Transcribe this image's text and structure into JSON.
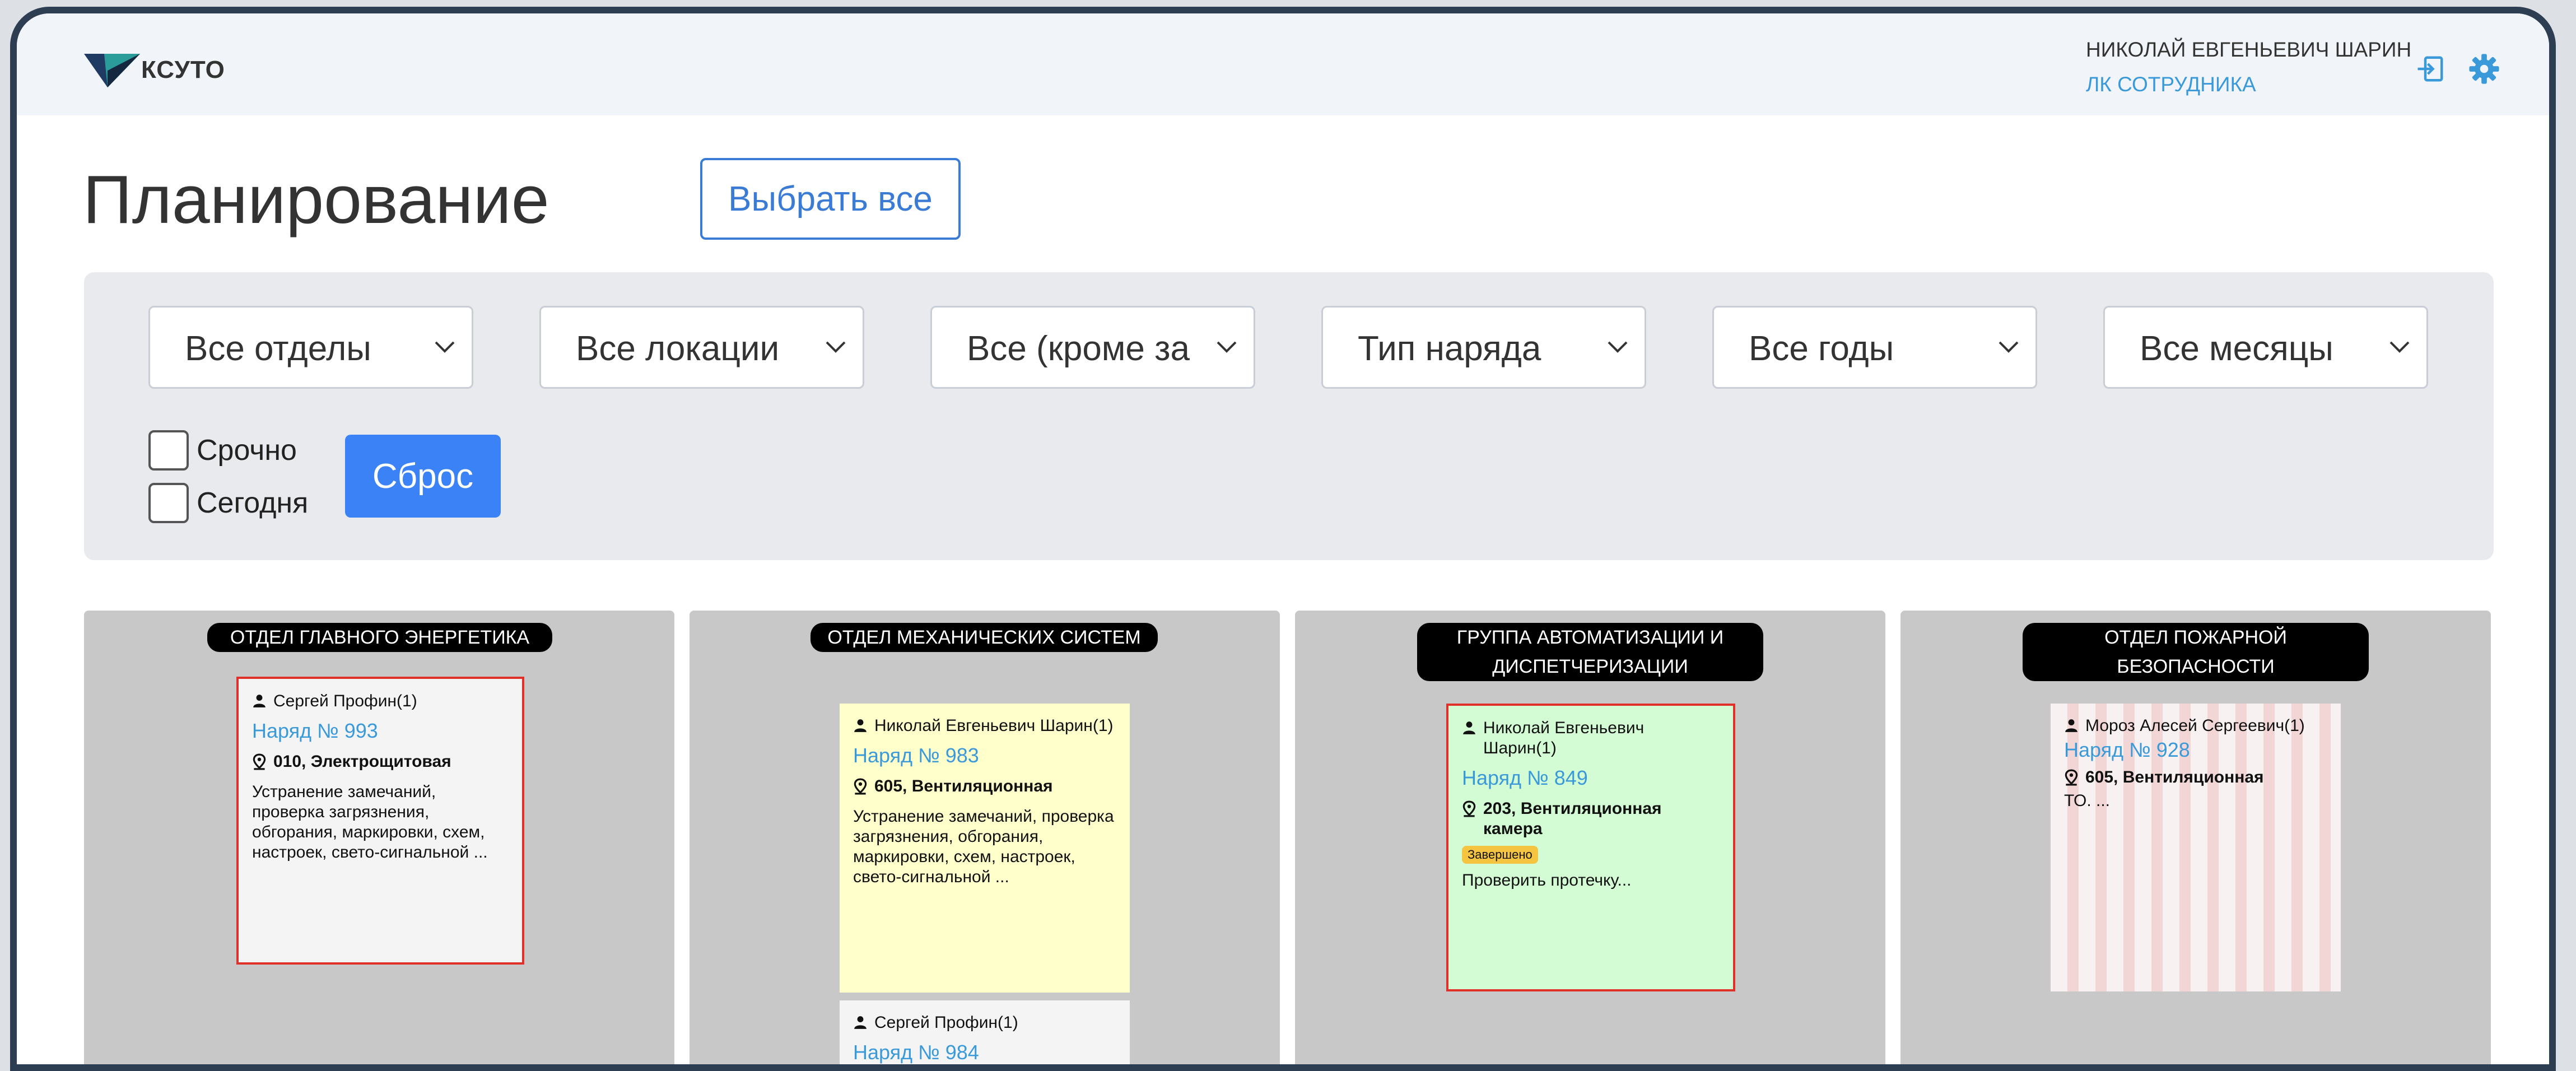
{
  "app": {
    "logo_text": "КСУТО",
    "user_name": "НИКОЛАЙ ЕВГЕНЬЕВИЧ ШАРИН",
    "user_link": "ЛК СОТРУДНИКА"
  },
  "page": {
    "title": "Планирование",
    "select_all_label": "Выбрать все"
  },
  "filters": {
    "selects": [
      {
        "value": "Все отделы"
      },
      {
        "value": "Все локации"
      },
      {
        "value": "Все (кроме за"
      },
      {
        "value": "Тип наряда"
      },
      {
        "value": "Все годы"
      },
      {
        "value": "Все месяцы"
      }
    ],
    "urgent_label": "Срочно",
    "today_label": "Сегодня",
    "reset_label": "Сброс"
  },
  "columns": [
    {
      "title": "ОТДЕЛ ГЛАВНОГО ЭНЕРГЕТИКА",
      "cards": [
        {
          "assignee": "Сергей Профин(1)",
          "order": "Наряд № 993",
          "location": "010, Электрощитовая",
          "status": "",
          "desc": "Устранение замечаний, проверка загрязнения, обгорания, маркировки, схем, настроек, свето-сигнальной ..."
        }
      ]
    },
    {
      "title": "ОТДЕЛ МЕХАНИЧЕСКИХ СИСТЕМ",
      "cards": [
        {
          "assignee": "Николай Евгеньевич Шарин(1)",
          "order": "Наряд № 983",
          "location": "605, Вентиляционная",
          "status": "",
          "desc": "Устранение замечаний, проверка загрязнения, обгорания, маркировки, схем, настроек, свето-сигнальной ..."
        },
        {
          "assignee": "Сергей Профин(1)",
          "order": "Наряд № 984",
          "location": "",
          "status": "",
          "desc": ""
        }
      ]
    },
    {
      "title": "ГРУППА АВТОМАТИЗАЦИИ И ДИСПЕТЧЕРИЗАЦИИ",
      "cards": [
        {
          "assignee": "Николай Евгеньевич Шарин(1)",
          "order": "Наряд № 849",
          "location": "203, Вентиляционная камера",
          "status": "Завершено",
          "desc": "Проверить протечку..."
        }
      ]
    },
    {
      "title": "ОТДЕЛ ПОЖАРНОЙ БЕЗОПАСНОСТИ",
      "cards": [
        {
          "assignee": "Мороз Алесей Сергеевич(1)",
          "order": "Наряд № 928",
          "location": "605, Вентиляционная",
          "status": "",
          "desc": "ТО. ..."
        }
      ]
    }
  ],
  "colors": {
    "accent": "#3a7bd5",
    "link": "#3a9ad9",
    "card_default": "#f4f4f4",
    "card_yellow": "#ffffcc",
    "card_green": "#d4fcd4",
    "card_highlight_border": "#e0302a",
    "badge_done": "#f5c542"
  }
}
